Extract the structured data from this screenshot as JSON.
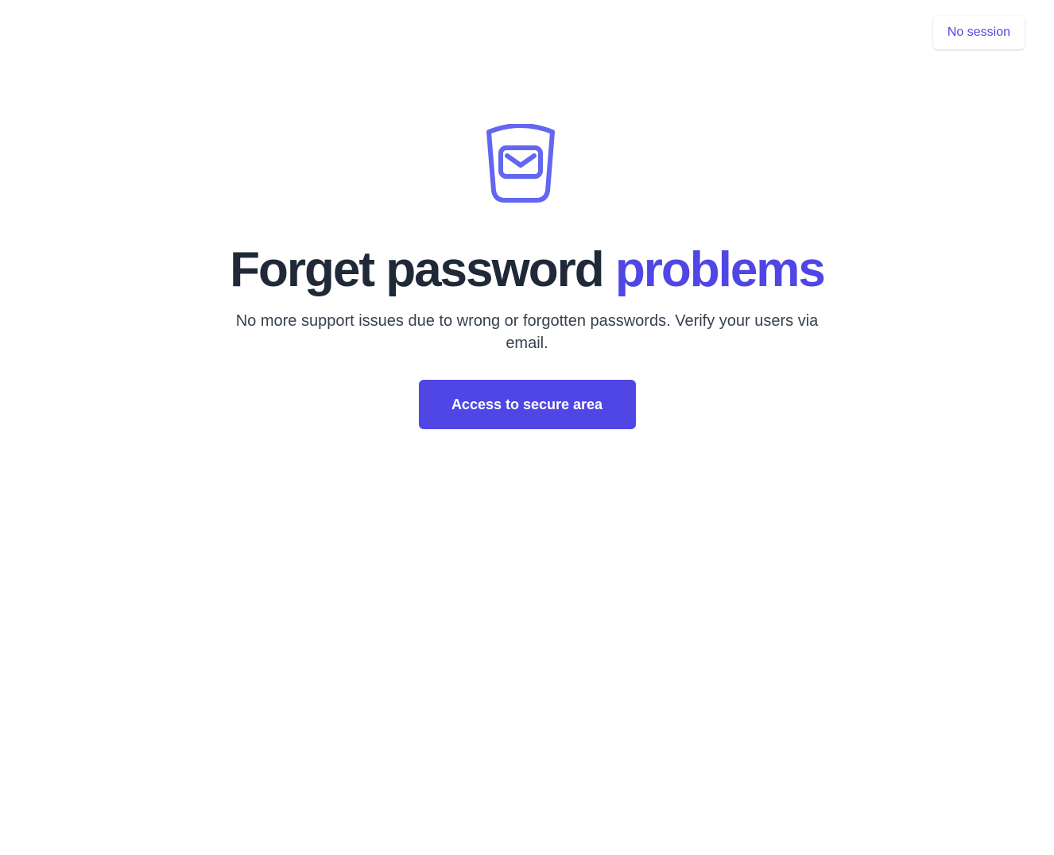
{
  "header": {
    "session_status": "No session"
  },
  "hero": {
    "logo_icon": "shield-mail-icon",
    "headline_main": "Forget password ",
    "headline_accent": "problems",
    "subtitle": "No more support issues due to wrong or forgotten passwords. Verify your users via email.",
    "cta_label": "Access to secure area"
  },
  "colors": {
    "accent": "#4f46e5",
    "icon": "#6366f1",
    "heading": "#1f2937",
    "body_text": "#374151",
    "background": "#ffffff"
  }
}
